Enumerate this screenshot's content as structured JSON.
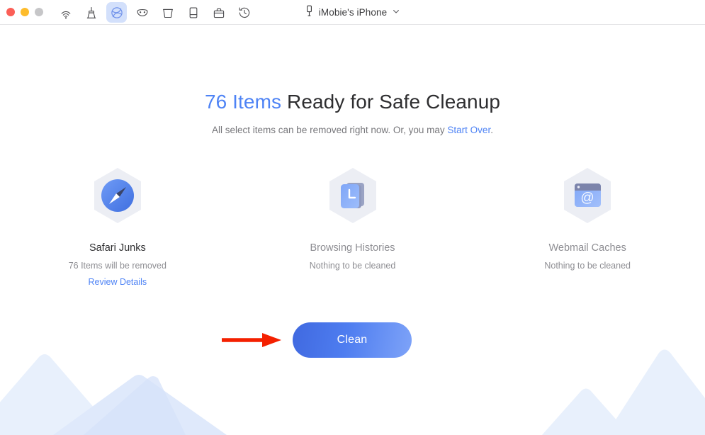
{
  "window": {
    "traffic_lights": [
      {
        "name": "close",
        "color": "#fb5f57"
      },
      {
        "name": "minimize",
        "color": "#fdbc2c"
      },
      {
        "name": "zoom",
        "color": "#c6c6c8"
      }
    ],
    "tabs": [
      {
        "icon": "airdrop-icon",
        "label": "AirDrop",
        "active": false
      },
      {
        "icon": "broom-icon",
        "label": "Clean",
        "active": false
      },
      {
        "icon": "globe-icon",
        "label": "Privacy",
        "active": true
      },
      {
        "icon": "mask-icon",
        "label": "Private Data",
        "active": false
      },
      {
        "icon": "trash-bin-icon",
        "label": "Junk Files",
        "active": false
      },
      {
        "icon": "device-icon",
        "label": "Device",
        "active": false
      },
      {
        "icon": "briefcase-icon",
        "label": "Toolkit",
        "active": false
      },
      {
        "icon": "history-icon",
        "label": "History",
        "active": false
      }
    ],
    "device": {
      "icon": "iphone-icon",
      "name": "iMobie's iPhone",
      "chevron": "chevron-down-icon"
    }
  },
  "main": {
    "headline": {
      "count": "76 Items",
      "rest": " Ready for Safe Cleanup"
    },
    "subtitle": {
      "prefix": "All select items can be removed right now. Or, you may ",
      "link": "Start Over",
      "suffix": "."
    },
    "categories": [
      {
        "icon": "safari-compass-icon",
        "title": "Safari Junks",
        "status": "76 Items will be removed",
        "link": "Review Details",
        "disabled": false
      },
      {
        "icon": "browsing-history-icon",
        "title": "Browsing Histories",
        "status": "Nothing to be cleaned",
        "link": "",
        "disabled": true
      },
      {
        "icon": "webmail-cache-icon",
        "title": "Webmail Caches",
        "status": "Nothing to be cleaned",
        "link": "",
        "disabled": true
      }
    ],
    "clean_button": {
      "label": "Clean"
    },
    "annotation": {
      "arrow": "red-arrow-pointer",
      "color": "#f42000"
    }
  },
  "colors": {
    "accent": "#4e83f5",
    "headline_text": "#2e2e30",
    "muted_text": "#8e8e93",
    "button_gradient_start": "#4069e0",
    "button_gradient_end": "#7ea3f8",
    "active_tab_bg": "#d3e0fb",
    "mountain_light": "#e8f0fc",
    "mountain_dark": "#d5e2f9"
  }
}
